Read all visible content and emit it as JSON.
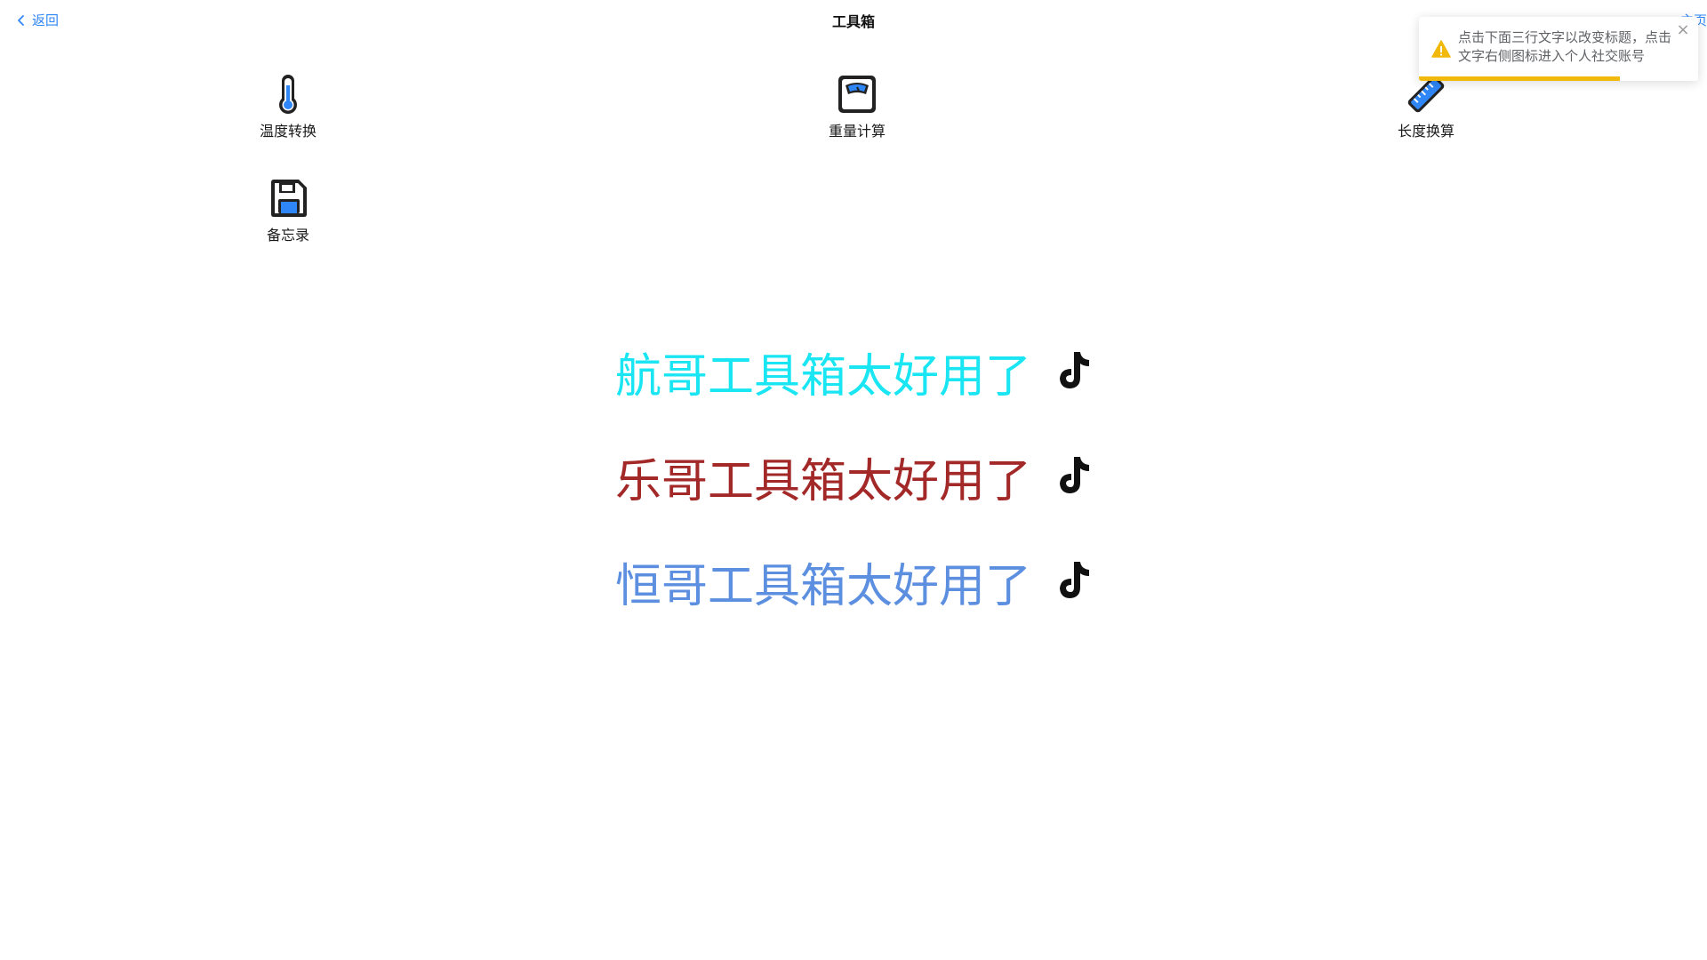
{
  "header": {
    "back_label": "返回",
    "title": "工具箱",
    "right_label": "主页"
  },
  "tools": [
    {
      "label": "温度转换",
      "icon": "thermometer-icon"
    },
    {
      "label": "重量计算",
      "icon": "weighing-scale-icon"
    },
    {
      "label": "长度换算",
      "icon": "ruler-icon"
    },
    {
      "label": "备忘录",
      "icon": "floppy-disk-icon"
    }
  ],
  "slogans": [
    {
      "text": "航哥工具箱太好用了",
      "color": "#19e6f2",
      "icon": "tiktok-icon"
    },
    {
      "text": "乐哥工具箱太好用了",
      "color": "#a32828",
      "icon": "tiktok-icon"
    },
    {
      "text": "恒哥工具箱太好用了",
      "color": "#5c8fe0",
      "icon": "tiktok-icon"
    }
  ],
  "toast": {
    "message": "点击下面三行文字以改变标题，点击文字右侧图标进入个人社交账号",
    "icon": "warning-icon",
    "close_icon": "close-icon",
    "progress": 0.72,
    "accent": "#f0b90b"
  },
  "colors": {
    "link": "#2f86f6",
    "icon_blue": "#2f86f6",
    "icon_outline": "#222222"
  }
}
